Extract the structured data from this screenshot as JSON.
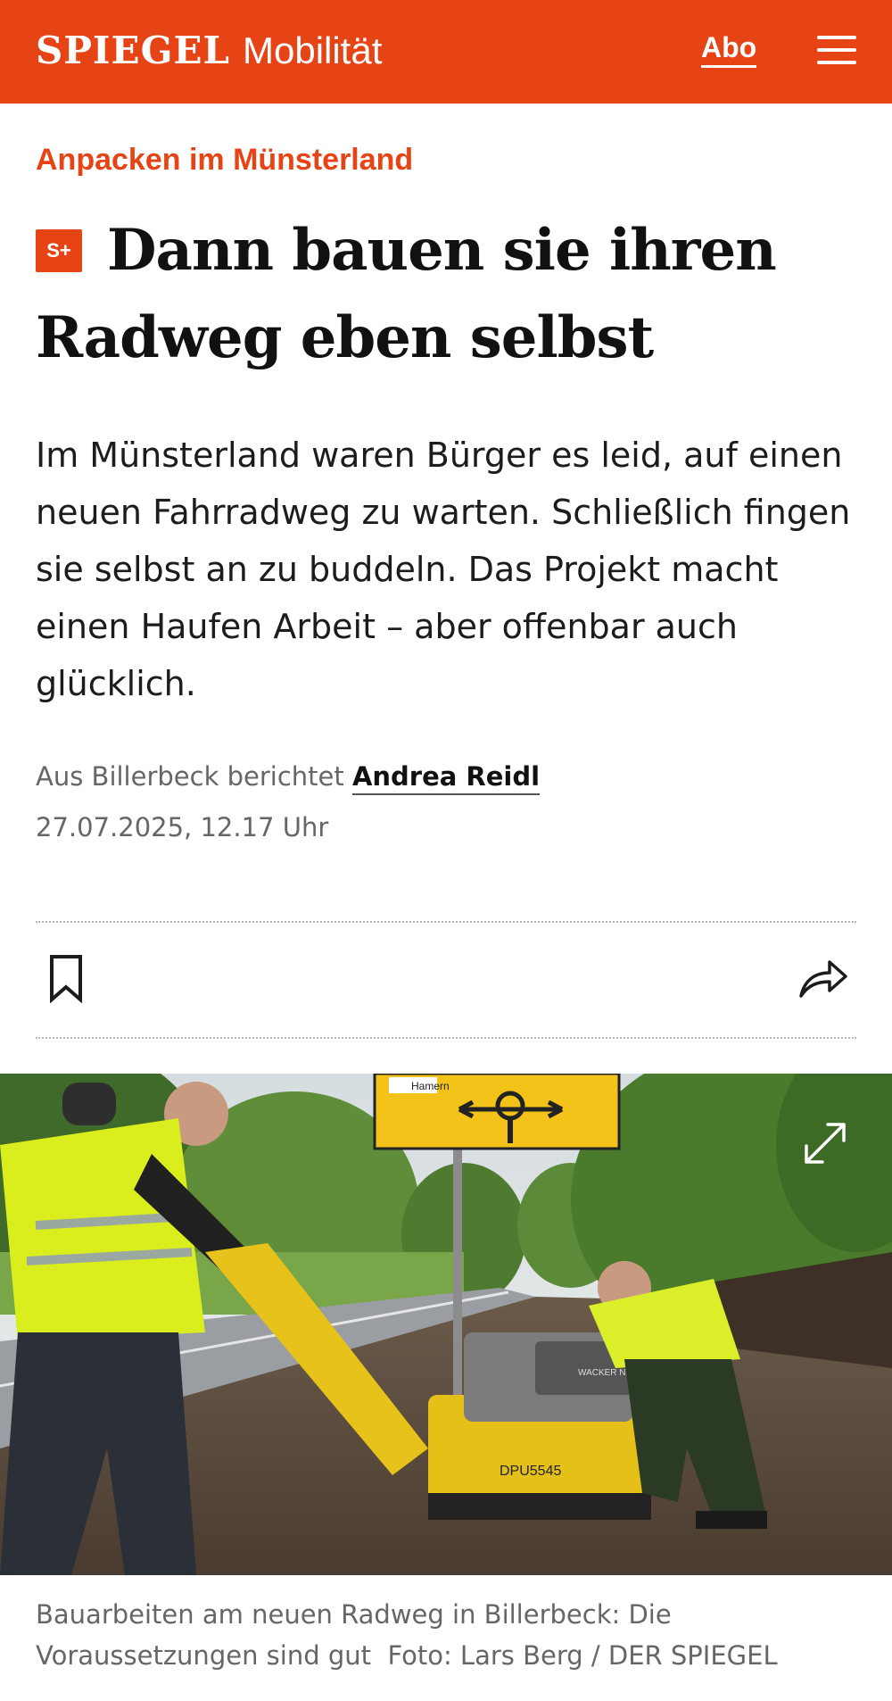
{
  "header": {
    "brand": "SPIEGEL",
    "section": "Mobilität",
    "abo_label": "Abo",
    "menu_icon": "hamburger-menu-icon",
    "background_color": "#e64415"
  },
  "article": {
    "kicker": "Anpacken im Münsterland",
    "badge": "S+",
    "headline": "Dann bauen sie ihren Radweg eben selbst",
    "teaser": "Im Münsterland waren Bürger es leid, auf einen neuen Fahrradweg zu warten. Schließlich fingen sie selbst an zu buddeln. Das Projekt macht einen Haufen Arbeit – aber offenbar auch glücklich.",
    "byline_prefix": "Aus Billerbeck berichtet",
    "author": "Andrea Reidl",
    "date": "27.07.2025, 12.17 Uhr",
    "accent_color": "#e64415"
  },
  "actions": {
    "bookmark_icon": "bookmark-icon",
    "share_icon": "share-icon"
  },
  "photo": {
    "sign_text": "Hamern",
    "machine_label": "DPU5545",
    "machine_brand": "WACKER NEUSON",
    "expand_icon": "expand-icon",
    "caption": "Bauarbeiten am neuen Radweg in Billerbeck: Die Voraussetzungen sind gut",
    "credit": "Foto: Lars Berg / DER SPIEGEL"
  }
}
